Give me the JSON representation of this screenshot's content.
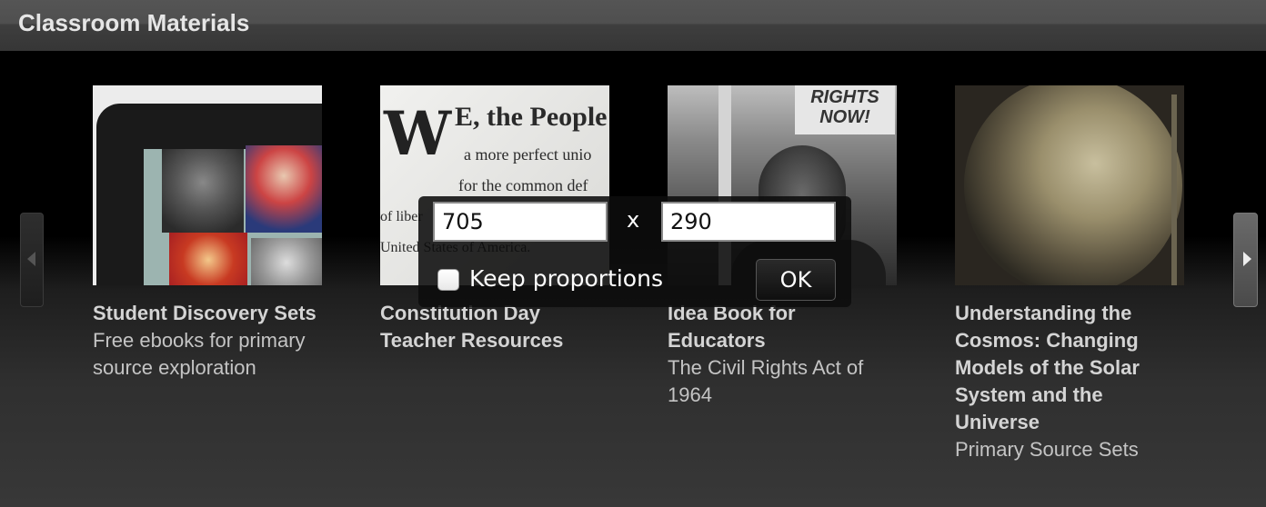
{
  "header": {
    "title": "Classroom Materials"
  },
  "nav": {
    "prev_icon": "chevron-left-icon",
    "next_icon": "chevron-right-icon"
  },
  "cards": [
    {
      "title": "Student Discovery Sets",
      "subtitle": "Free ebooks for primary source exploration",
      "image": "tablet-with-historical-photos"
    },
    {
      "title": "Constitution Day Teacher Resources",
      "subtitle": "",
      "image": "constitution-preamble-document",
      "image_text": {
        "initial": "W",
        "line1": "E, the People",
        "line2": "a more perfect unio",
        "line3": "for the common def",
        "line4": "of liber",
        "line5": "United States of America."
      }
    },
    {
      "title": "Idea Book for Educators",
      "subtitle": "The Civil Rights Act of 1964",
      "image": "civil-rights-march-photo",
      "image_text": {
        "sign": "RIGHTS NOW!"
      }
    },
    {
      "title": "Understanding the Cosmos: Changing Models of the Solar System and the Universe",
      "subtitle": "Primary Source Sets",
      "image": "antique-globe"
    }
  ],
  "dialog": {
    "width_value": "705",
    "separator": "x",
    "height_value": "290",
    "keep_proportions_label": "Keep proportions",
    "keep_proportions_checked": false,
    "ok_label": "OK"
  }
}
